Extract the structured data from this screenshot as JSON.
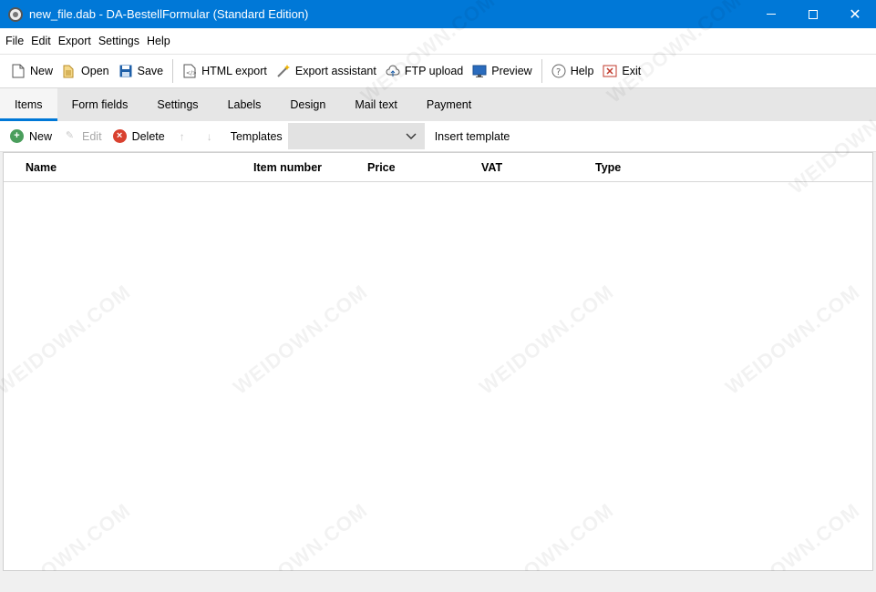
{
  "window": {
    "title": "new_file.dab - DA-BestellFormular (Standard Edition)",
    "minimize": "",
    "maximize": "",
    "close": "✕"
  },
  "menu": [
    "File",
    "Edit",
    "Export",
    "Settings",
    "Help"
  ],
  "toolbar": {
    "new": "New",
    "open": "Open",
    "save": "Save",
    "html_export": "HTML export",
    "export_assistant": "Export assistant",
    "ftp_upload": "FTP upload",
    "preview": "Preview",
    "help": "Help",
    "exit": "Exit"
  },
  "tabs": [
    "Items",
    "Form fields",
    "Settings",
    "Labels",
    "Design",
    "Mail text",
    "Payment"
  ],
  "active_tab": "Items",
  "items_toolbar": {
    "new": "New",
    "edit": "Edit",
    "delete": "Delete",
    "templates_label": "Templates",
    "templates_value": "",
    "insert_template": "Insert template"
  },
  "grid": {
    "columns": [
      "Name",
      "Item number",
      "Price",
      "VAT",
      "Type"
    ],
    "rows": []
  },
  "watermark_text": "WEIDOWN.COM",
  "colors": {
    "titlebar": "#0078d7",
    "tab_accent": "#0078d7",
    "new_icon": "#4a9e5c",
    "delete_icon": "#d9412f"
  }
}
